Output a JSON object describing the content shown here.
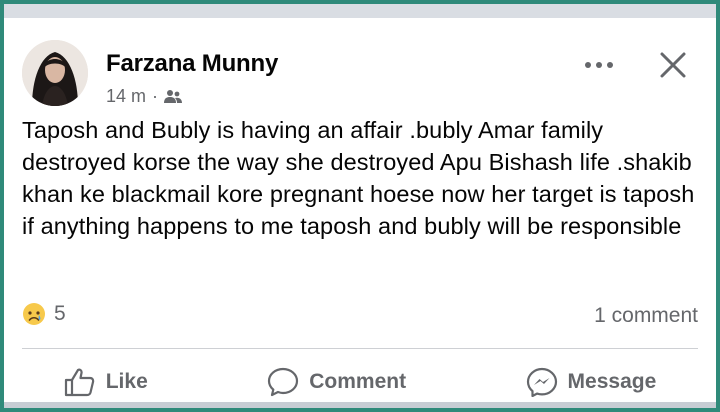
{
  "post": {
    "author": "Farzana Munny",
    "time": "14 m",
    "separator": "·",
    "audience_icon": "friends-icon",
    "text": "Taposh and Bubly is having an affair .bubly Amar family destroyed korse the way she destroyed Apu Bishash life .shakib khan ke blackmail kore pregnant hoese now her target is taposh if anything happens to me taposh and bubly will be responsible",
    "reaction_icon": "sad-face-icon",
    "reaction_count": "5",
    "comment_count": "1 comment"
  },
  "actions": {
    "like": "Like",
    "comment": "Comment",
    "message": "Message"
  },
  "colors": {
    "text_primary": "#050505",
    "text_secondary": "#65676b",
    "border_teal": "#2f8a7a"
  }
}
